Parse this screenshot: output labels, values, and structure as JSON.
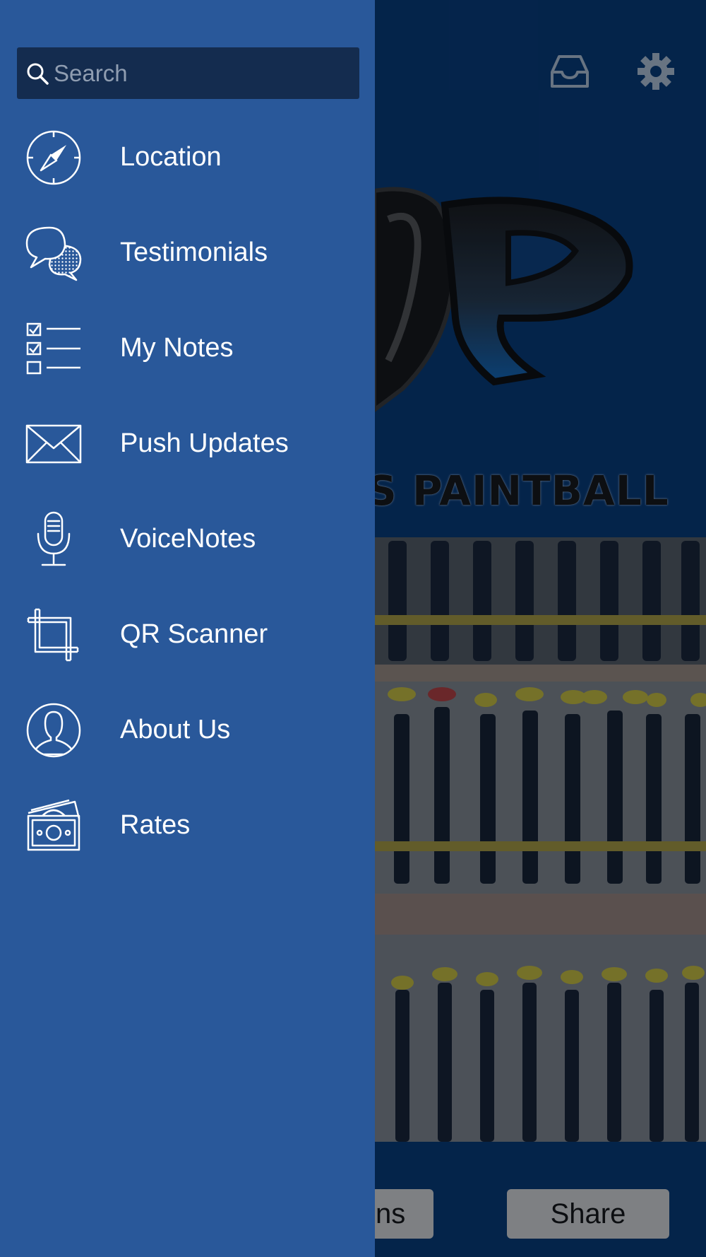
{
  "header": {
    "inbox_icon": "inbox-icon",
    "settings_icon": "gear-icon"
  },
  "drawer": {
    "search": {
      "placeholder": "Search",
      "value": ""
    },
    "items": [
      {
        "label": "Location",
        "icon": "compass-icon"
      },
      {
        "label": "Testimonials",
        "icon": "speech-bubbles-icon"
      },
      {
        "label": "My Notes",
        "icon": "checklist-icon"
      },
      {
        "label": "Push Updates",
        "icon": "envelope-icon"
      },
      {
        "label": "VoiceNotes",
        "icon": "microphone-icon"
      },
      {
        "label": "QR Scanner",
        "icon": "crop-icon"
      },
      {
        "label": "About Us",
        "icon": "user-icon"
      },
      {
        "label": "Rates",
        "icon": "money-icon"
      }
    ]
  },
  "background": {
    "brand_text": "S PAINTBALL",
    "bottom_buttons": [
      {
        "label": "ons"
      },
      {
        "label": "Share"
      }
    ]
  },
  "colors": {
    "drawer_bg": "#29589a",
    "search_bg": "#142c4f",
    "app_bg": "#062a55"
  }
}
